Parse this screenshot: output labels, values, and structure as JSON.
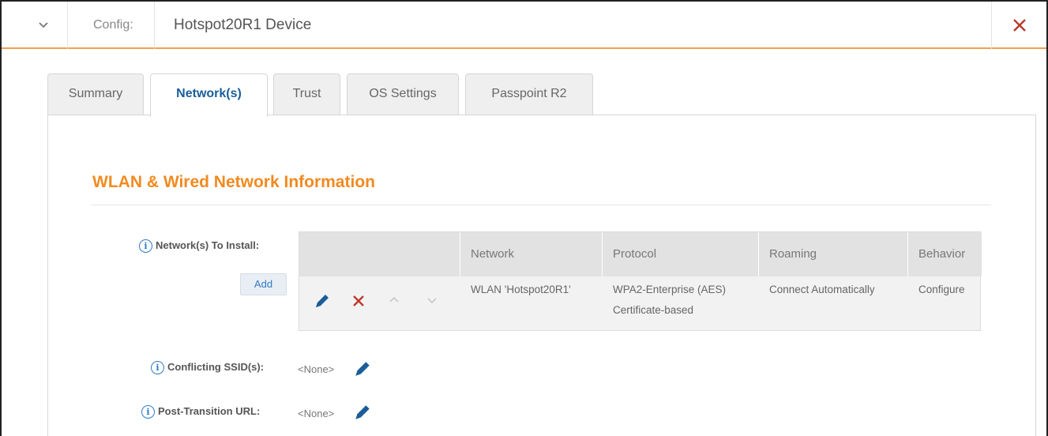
{
  "header": {
    "config_label": "Config:",
    "config_title": "Hotspot20R1 Device"
  },
  "tabs": [
    {
      "label": "Summary",
      "active": false
    },
    {
      "label": "Network(s)",
      "active": true
    },
    {
      "label": "Trust",
      "active": false
    },
    {
      "label": "OS Settings",
      "active": false
    },
    {
      "label": "Passpoint R2",
      "active": false
    }
  ],
  "section": {
    "title": "WLAN & Wired Network Information"
  },
  "networks_to_install": {
    "label": "Network(s) To Install:",
    "add_label": "Add",
    "columns": [
      "",
      "Network",
      "Protocol",
      "Roaming",
      "Behavior"
    ],
    "rows": [
      {
        "network": "WLAN 'Hotspot20R1'",
        "protocol_line1": "WPA2-Enterprise (AES)",
        "protocol_line2": "Certificate-based",
        "roaming": "Connect Automatically",
        "behavior": "Configure"
      }
    ]
  },
  "conflicting_ssids": {
    "label": "Conflicting SSID(s):",
    "value": "<None>"
  },
  "post_transition_url": {
    "label": "Post-Transition URL:",
    "value": "<None>"
  },
  "colors": {
    "accent_orange": "#f28a1f",
    "header_rule": "#f0a04b",
    "active_tab_text": "#1b5d99",
    "icon_blue": "#1b5d99",
    "delete_red": "#c0392b",
    "close_red": "#b53a2e"
  },
  "icons": {
    "collapse": "chevron-down-icon",
    "close": "close-icon",
    "info": "info-icon",
    "edit": "pencil-icon",
    "delete": "delete-x-icon",
    "move_up": "chevron-up-icon",
    "move_down": "chevron-down-icon"
  }
}
